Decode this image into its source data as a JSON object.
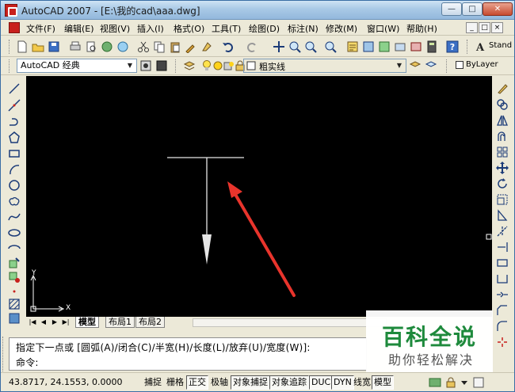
{
  "window": {
    "title": "AutoCAD 2007 - [E:\\我的cad\\aaa.dwg]",
    "buttons": {
      "minimize": "—",
      "maximize": "□",
      "close": "✕"
    }
  },
  "menu": {
    "items": [
      "文件(F)",
      "编辑(E)",
      "视图(V)",
      "插入(I)",
      "格式(O)",
      "工具(T)",
      "绘图(D)",
      "标注(N)",
      "修改(M)",
      "窗口(W)",
      "帮助(H)"
    ],
    "doc_buttons": [
      "_",
      "□",
      "×"
    ]
  },
  "toolbar1": {
    "text_style": "Stand"
  },
  "toolbar2": {
    "workspace": "AutoCAD 经典",
    "layer": "粗实线",
    "color": "ByLayer"
  },
  "canvas": {
    "background": "#000000",
    "ucs_x": "X",
    "ucs_y": "Y",
    "arrow_color": "#e8342c"
  },
  "tabs": {
    "items": [
      "模型",
      "布局1",
      "布局2"
    ],
    "active": 0
  },
  "command": {
    "history": "指定下一点或 [圆弧(A)/闭合(C)/半宽(H)/长度(L)/放弃(U)/宽度(W)]:",
    "prompt": "命令:"
  },
  "status": {
    "coords": "43.8717, 24.1553, 0.0000",
    "buttons": [
      {
        "label": "捕捉",
        "on": false
      },
      {
        "label": "栅格",
        "on": false
      },
      {
        "label": "正交",
        "on": true
      },
      {
        "label": "极轴",
        "on": false
      },
      {
        "label": "对象捕捉",
        "on": true
      },
      {
        "label": "对象追踪",
        "on": true
      },
      {
        "label": "DUCS",
        "on": true
      },
      {
        "label": "DYN",
        "on": true
      },
      {
        "label": "线宽",
        "on": false
      },
      {
        "label": "模型",
        "on": true
      }
    ]
  },
  "watermark": {
    "title": "百科全说",
    "subtitle": "助你轻松解决",
    "color": "#1e8a3c"
  }
}
